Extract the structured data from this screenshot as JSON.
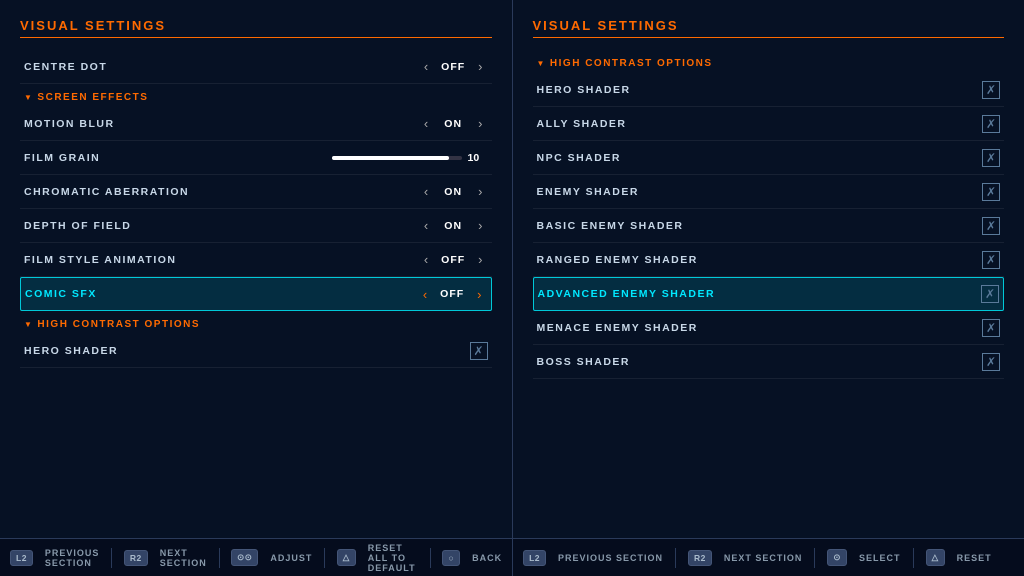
{
  "left_panel": {
    "title": "VISUAL SETTINGS",
    "rows": [
      {
        "id": "centre-dot",
        "label": "CENTRE DOT",
        "type": "toggle",
        "value": "OFF",
        "highlighted": false
      },
      {
        "id": "screen-effects",
        "label": "SCREEN EFFECTS",
        "type": "section-header"
      },
      {
        "id": "motion-blur",
        "label": "MOTION BLUR",
        "type": "toggle",
        "value": "ON",
        "highlighted": false
      },
      {
        "id": "film-grain",
        "label": "FILM GRAIN",
        "type": "slider",
        "value": "10",
        "highlighted": false
      },
      {
        "id": "chromatic-aberration",
        "label": "CHROMATIC ABERRATION",
        "type": "toggle",
        "value": "ON",
        "highlighted": false
      },
      {
        "id": "depth-of-field",
        "label": "DEPTH OF FIELD",
        "type": "toggle",
        "value": "ON",
        "highlighted": false
      },
      {
        "id": "film-style-animation",
        "label": "FILM STYLE ANIMATION",
        "type": "toggle",
        "value": "OFF",
        "highlighted": false
      },
      {
        "id": "comic-sfx",
        "label": "COMIC SFX",
        "type": "toggle",
        "value": "OFF",
        "highlighted": true
      },
      {
        "id": "high-contrast-options",
        "label": "HIGH CONTRAST OPTIONS",
        "type": "section-header"
      },
      {
        "id": "hero-shader",
        "label": "HERO SHADER",
        "type": "checkbox",
        "highlighted": false
      }
    ]
  },
  "right_panel": {
    "title": "VISUAL SETTINGS",
    "section_header": "HIGH CONTRAST OPTIONS",
    "rows": [
      {
        "id": "hero-shader",
        "label": "HERO SHADER",
        "type": "checkbox",
        "highlighted": false
      },
      {
        "id": "ally-shader",
        "label": "ALLY SHADER",
        "type": "checkbox",
        "highlighted": false
      },
      {
        "id": "npc-shader",
        "label": "NPC SHADER",
        "type": "checkbox",
        "highlighted": false
      },
      {
        "id": "enemy-shader",
        "label": "ENEMY SHADER",
        "type": "checkbox",
        "highlighted": false
      },
      {
        "id": "basic-enemy-shader",
        "label": "BASIC ENEMY SHADER",
        "type": "checkbox",
        "highlighted": false
      },
      {
        "id": "ranged-enemy-shader",
        "label": "RANGED ENEMY SHADER",
        "type": "checkbox",
        "highlighted": false
      },
      {
        "id": "advanced-enemy-shader",
        "label": "ADVANCED ENEMY SHADER",
        "type": "checkbox",
        "highlighted": true
      },
      {
        "id": "menace-enemy-shader",
        "label": "MENACE ENEMY SHADER",
        "type": "checkbox",
        "highlighted": false
      },
      {
        "id": "boss-shader",
        "label": "BOSS SHADER",
        "type": "checkbox",
        "highlighted": false
      }
    ]
  },
  "footer_left": {
    "items": [
      {
        "badge": "L2",
        "label": "PREVIOUS SECTION"
      },
      {
        "badge": "R2",
        "label": "NEXT SECTION"
      },
      {
        "badge": "⊙⊙",
        "label": "ADJUST"
      },
      {
        "badge": "△",
        "label": "RESET ALL TO DEFAULT"
      },
      {
        "badge": "○",
        "label": "BACK"
      }
    ]
  },
  "footer_right": {
    "items": [
      {
        "badge": "L2",
        "label": "PREVIOUS SECTION"
      },
      {
        "badge": "R2",
        "label": "NEXT SECTION"
      },
      {
        "badge": "⊙",
        "label": "SELECT"
      },
      {
        "badge": "△",
        "label": "RESET"
      }
    ]
  }
}
